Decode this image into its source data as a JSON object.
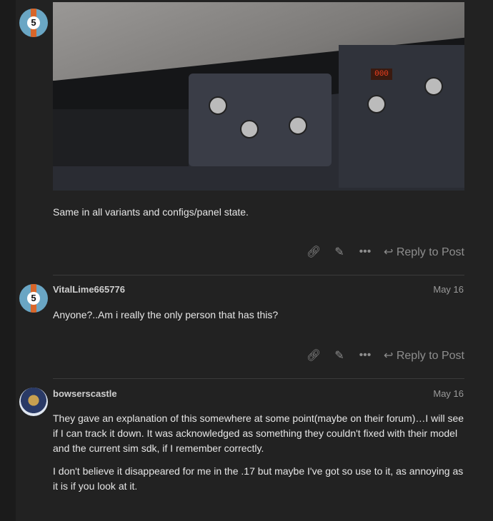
{
  "posts": [
    {
      "avatar": "gulf-5-avatar",
      "body": "Same in all variants and configs/panel state.",
      "actions": {
        "link": "link-icon",
        "edit": "pencil-icon",
        "more": "ellipsis-icon",
        "reply_label": "Reply to Post"
      }
    },
    {
      "username": "VitalLime665776",
      "date": "May 16",
      "avatar": "gulf-5-avatar",
      "body": "Anyone?..Am i really the only person that has this?",
      "actions": {
        "link": "link-icon",
        "edit": "pencil-icon",
        "more": "ellipsis-icon",
        "reply_label": "Reply to Post"
      }
    },
    {
      "username": "bowserscastle",
      "date": "May 16",
      "avatar": "bowser-avatar",
      "paragraphs": [
        "They gave an explanation of this somewhere at some point(maybe on their forum)…I will see if I can track it down. It was acknowledged as something they couldn't fixed with their model and the current sim sdk, if I remember correctly.",
        "I don't believe it disappeared for me in the .17 but maybe I've got so use to it, as annoying as it is if you look at it."
      ]
    }
  ],
  "screenshot": {
    "course_display": "000"
  }
}
